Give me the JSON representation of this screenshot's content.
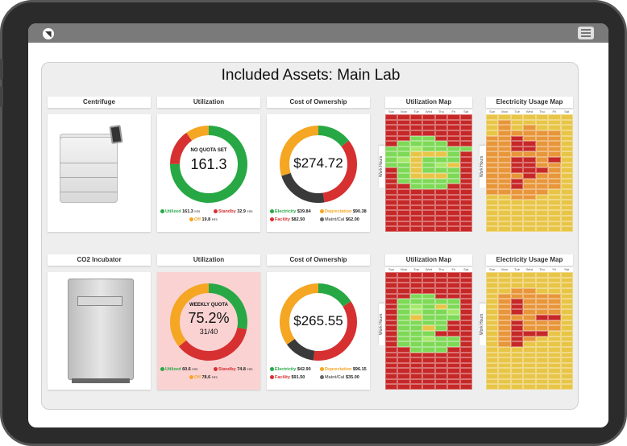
{
  "app": {
    "logo_glyph": "◥",
    "menu_icon": "hamburger-icon"
  },
  "page_title": "Included Assets: Main Lab",
  "colors": {
    "green": "#27a844",
    "orange": "#f5a623",
    "red": "#d63031",
    "dark": "#3a3a3a",
    "heat_red": "#c62828",
    "heat_green": "#7ed957",
    "heat_lightgreen": "#a6e86a",
    "heat_yellow": "#e8c547",
    "heat_orange": "#e8963a"
  },
  "days": [
    "Sun",
    "Mon",
    "Tue",
    "Wed",
    "Thu",
    "Fri",
    "Sat"
  ],
  "work_hours_label": "Work Hours",
  "assets": [
    {
      "name": "Centrifuge",
      "utilization_header": "Utilization",
      "cost_header": "Cost of Ownership",
      "util_map_header": "Utilization Map",
      "elec_map_header": "Electricity Usage Map",
      "quota_label": "NO QUOTA SET",
      "quota_value": "161.3",
      "quota_sub": "",
      "util_segments": [
        {
          "name": "Utilized",
          "fraction": 0.75,
          "color": "#27a844"
        },
        {
          "name": "Standby",
          "fraction": 0.15,
          "color": "#d63031"
        },
        {
          "name": "Off",
          "fraction": 0.1,
          "color": "#f5a623"
        }
      ],
      "util_legend": [
        {
          "label": "Utilized",
          "value": "161.3",
          "unit": "Hrs",
          "color": "#27a844"
        },
        {
          "label": "Standby",
          "value": "32.9",
          "unit": "Hrs",
          "color": "#d63031"
        },
        {
          "label": "Off",
          "value": "19.8",
          "unit": "Hrs",
          "color": "#f5a623"
        }
      ],
      "cost_total": "$274.72",
      "cost_segments": [
        {
          "name": "Electricity",
          "fraction": 0.145,
          "color": "#27a844"
        },
        {
          "name": "Depreciation",
          "fraction": 0.329,
          "color": "#d63031"
        },
        {
          "name": "Maint/Cal",
          "fraction": 0.226,
          "color": "#3a3a3a"
        },
        {
          "name": "Facility",
          "fraction": 0.3,
          "color": "#f5a623"
        }
      ],
      "cost_legend": [
        {
          "label": "Electricity",
          "value": "$39.84",
          "color": "#27a844"
        },
        {
          "label": "Depreciation",
          "value": "$90.38",
          "color": "#f5a623"
        },
        {
          "label": "Facility",
          "value": "$82.50",
          "color": "#d63031"
        },
        {
          "label": "Maint/Cal",
          "value": "$62.00",
          "color": "#666666"
        }
      ],
      "util_map": [
        "RRRRRRR",
        "RRRRRRR",
        "RRRRRRR",
        "RRRRRRR",
        "RRGGRRR",
        "RGGGGRR",
        "GGLGGGG",
        "GGYYYGR",
        "GLYGGGR",
        "GGYGLYR",
        "RGYGGGR",
        "RGYYYGR",
        "RGGGGGR",
        "RRGGGRR",
        "RRRRRRR",
        "RRRRRRR",
        "RRRRRRR",
        "RRRRRRR",
        "RRRRRRR",
        "RRRRRRR",
        "RRRRRRR",
        "RRRRRRR"
      ],
      "elec_map": [
        "YYYYYYY",
        "YOYYYYY",
        "YOYOYYY",
        "YOOOOOY",
        "OOROOOY",
        "OORROOY",
        "OORROOY",
        "OOOOOOY",
        "OORRORY",
        "OORROOY",
        "OORRROY",
        "OOOROOY",
        "OOROOOY",
        "OOROOOY",
        "OOOOOYY",
        "YYOOYYY",
        "YYYYYYY",
        "YYYYYYY",
        "YYYYYYY",
        "YYYYYYY",
        "YYYYYYY",
        "YYYYYYY"
      ]
    },
    {
      "name": "CO2 Incubator",
      "utilization_header": "Utilization",
      "cost_header": "Cost of Ownership",
      "util_map_header": "Utilization Map",
      "elec_map_header": "Electricity Usage Map",
      "quota_label": "WEEKLY QUOTA",
      "quota_value": "75.2%",
      "quota_sub": "31/40",
      "util_segments": [
        {
          "name": "Utilized",
          "fraction": 0.28,
          "color": "#27a844"
        },
        {
          "name": "Standby",
          "fraction": 0.36,
          "color": "#d63031"
        },
        {
          "name": "Off",
          "fraction": 0.36,
          "color": "#f5a623"
        }
      ],
      "util_legend": [
        {
          "label": "Utilized",
          "value": "60.6",
          "unit": "Hrs",
          "color": "#27a844"
        },
        {
          "label": "Standby",
          "value": "74.8",
          "unit": "Hrs",
          "color": "#d63031"
        },
        {
          "label": "Off",
          "value": "78.6",
          "unit": "Hrs",
          "color": "#f5a623"
        }
      ],
      "cost_total": "$265.55",
      "cost_segments": [
        {
          "name": "Electricity",
          "fraction": 0.16,
          "color": "#27a844"
        },
        {
          "name": "Depreciation",
          "fraction": 0.36,
          "color": "#d63031"
        },
        {
          "name": "Maint/Cal",
          "fraction": 0.13,
          "color": "#3a3a3a"
        },
        {
          "name": "Facility",
          "fraction": 0.35,
          "color": "#f5a623"
        }
      ],
      "cost_legend": [
        {
          "label": "Electricity",
          "value": "$42.90",
          "color": "#27a844"
        },
        {
          "label": "Depreciation",
          "value": "$96.15",
          "color": "#f5a623"
        },
        {
          "label": "Facility",
          "value": "$91.50",
          "color": "#d63031"
        },
        {
          "label": "Maint/Cal",
          "value": "$35.00",
          "color": "#666666"
        }
      ],
      "util_map": [
        "RRRRRRR",
        "RRRRRRR",
        "RRRRRRR",
        "RRRRRRR",
        "RRGGRRR",
        "RGGGGGR",
        "RGLGYGR",
        "RGLGGLR",
        "RGYGGGR",
        "RGGGGRR",
        "RGGYGRR",
        "RGGGRRR",
        "RGGLGGR",
        "RGGGGGR",
        "RRGGGRR",
        "RRRRRRR",
        "RRRRRRR",
        "RRRRRRR",
        "RRRRRRR",
        "RRRRRRR",
        "RRRRRRR",
        "RRRRRRR"
      ],
      "elec_map": [
        "YYYYYYY",
        "YYYYYYY",
        "YYYYYYY",
        "YYOOYYY",
        "YOOOOOY",
        "YOROOOY",
        "YOROOOY",
        "YOROOOY",
        "YOOORRY",
        "YOROOOY",
        "YOROOOY",
        "YORRRYY",
        "YOROYYY",
        "YORYYYY",
        "YYYYYYY",
        "YYYYYYY",
        "YYYYYYY",
        "YYYYYYY",
        "YYYYYYY",
        "YYYYYYY",
        "YYYYYYY",
        "YYYYYYY"
      ]
    }
  ]
}
